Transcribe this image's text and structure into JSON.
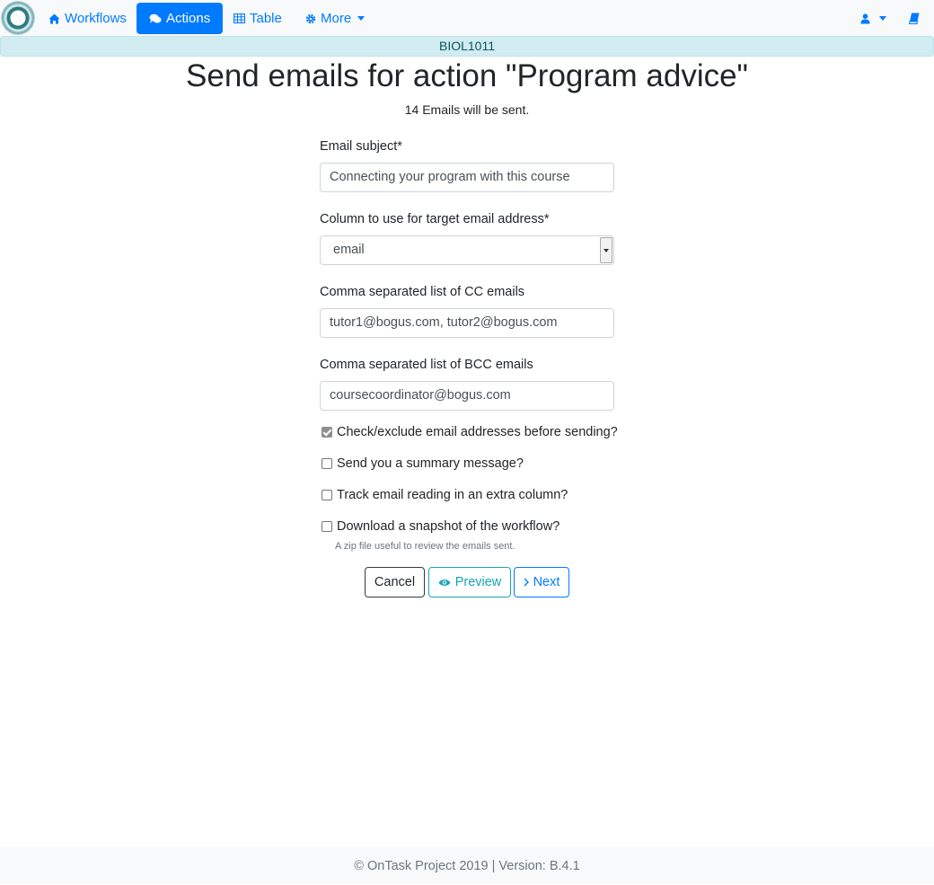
{
  "navbar": {
    "workflows_label": "Workflows",
    "actions_label": "Actions",
    "table_label": "Table",
    "more_label": "More"
  },
  "banner": {
    "text": "BIOL1011"
  },
  "page": {
    "title": "Send emails for action \"Program advice\"",
    "subtitle": "14 Emails will be sent."
  },
  "form": {
    "subject_label": "Email subject*",
    "subject_value": "Connecting your program with this course",
    "column_label": "Column to use for target email address*",
    "column_value": "email",
    "cc_label": "Comma separated list of CC emails",
    "cc_value": "tutor1@bogus.com, tutor2@bogus.com",
    "bcc_label": "Comma separated list of BCC emails",
    "bcc_value": "coursecoordinator@bogus.com",
    "check_exclude_label": "Check/exclude email addresses before sending?",
    "summary_label": "Send you a summary message?",
    "track_label": "Track email reading in an extra column?",
    "snapshot_label": "Download a snapshot of the workflow?",
    "snapshot_help": "A zip file useful to review the emails sent."
  },
  "buttons": {
    "cancel": "Cancel",
    "preview": "Preview",
    "next": "Next"
  },
  "footer": {
    "text": "© OnTask Project 2019 | Version: B.4.1"
  },
  "colors": {
    "primary": "#007bff",
    "info": "#17a2b8",
    "banner_bg": "#d1ecf1",
    "navbar_bg": "#f8f9fa"
  }
}
